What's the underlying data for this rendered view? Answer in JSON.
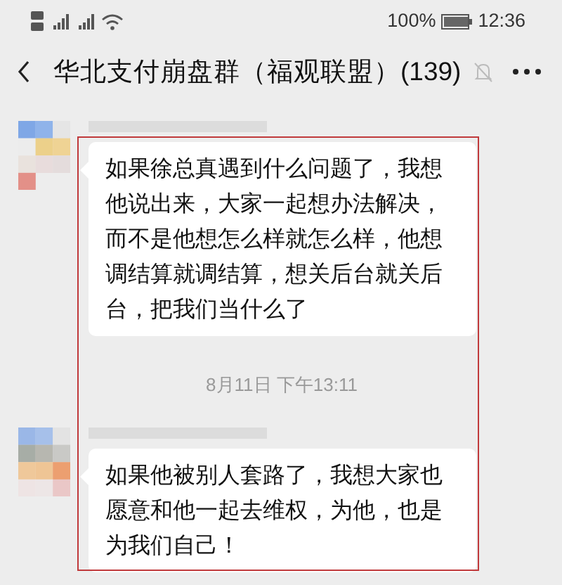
{
  "status_bar": {
    "battery": "100%",
    "time": "12:36"
  },
  "header": {
    "title": "华北支付崩盘群（福观联盟）(139)",
    "muted": true
  },
  "messages": [
    {
      "kind": "message",
      "text": "如果徐总真遇到什么问题了，我想他说出来，大家一起想办法解决，而不是他想怎么样就怎么样，他想调结算就调结算，想关后台就关后台，把我们当什么了"
    },
    {
      "kind": "time",
      "text": "8月11日 下午13:11"
    },
    {
      "kind": "message",
      "text": "如果他被别人套路了，我想大家也愿意和他一起去维权，为他，也是为我们自己！"
    }
  ]
}
